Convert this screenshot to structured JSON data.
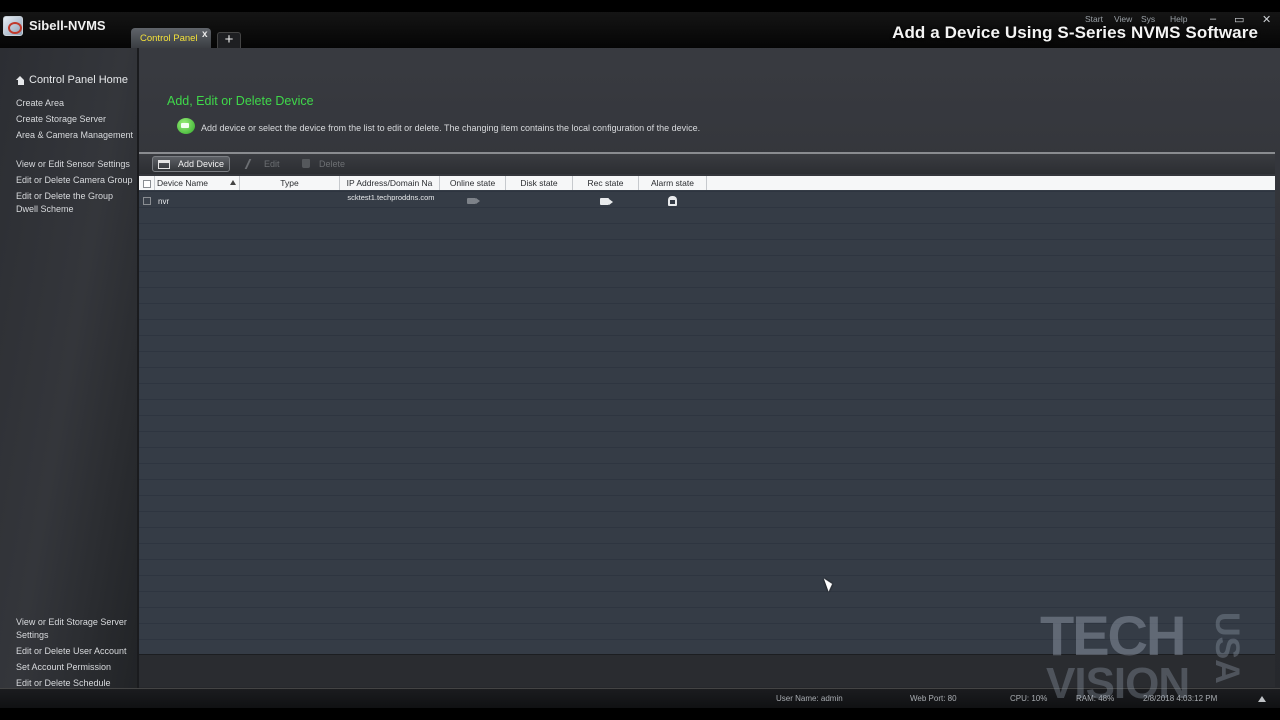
{
  "window": {
    "app_name": "Sibell-NVMS",
    "tab_label": "Control Panel",
    "tab_close": "x",
    "new_tab": "+",
    "menu": [
      "Start",
      "View",
      "Sys",
      "Help"
    ],
    "controls": [
      "–",
      "▭",
      "✕"
    ],
    "video_caption": "Add a Device Using S-Series NVMS Software"
  },
  "sidebar": {
    "home": "Control Panel Home",
    "top_links": [
      "Create Area",
      "Create Storage Server",
      "Area & Camera Management",
      "View or Edit Sensor Settings",
      "Edit or Delete Camera Group",
      "Edit or Delete the Group Dwell Scheme"
    ],
    "bottom_links": [
      "View or Edit Storage Server Settings",
      "Edit or Delete User Account",
      "Set Account Permission",
      "Edit or Delete Schedule"
    ]
  },
  "main": {
    "title": "Add, Edit or Delete Device",
    "info": "Add device or select the device from the list to edit or delete. The changing item contains the local configuration of the device.",
    "toolbar": {
      "add_device": "Add Device",
      "edit": "Edit",
      "delete": "Delete"
    },
    "columns": [
      "Device Name",
      "Type",
      "IP Address/Domain Na",
      "Online state",
      "Disk state",
      "Rec state",
      "Alarm state"
    ],
    "rows": [
      {
        "device_name": "nvr",
        "type": "",
        "ip": "scktest1.techproddns.com",
        "online_state_icon": "camera-offline-icon",
        "rec_state_icon": "camera-record-icon",
        "alarm_state_icon": "alarm-icon"
      }
    ]
  },
  "status": {
    "user": "User Name: admin",
    "web_port": "Web Port: 80",
    "cpu": "CPU: 10%",
    "ram": "RAM: 48%",
    "datetime": "2/8/2018 4:03:12 PM"
  },
  "watermark": {
    "line1": "TECH",
    "line2": "VISION",
    "side": "USA"
  },
  "colors": {
    "accent_green": "#3fd84a",
    "tab_label": "#f5e23a",
    "grid_bg": "#333a44"
  }
}
